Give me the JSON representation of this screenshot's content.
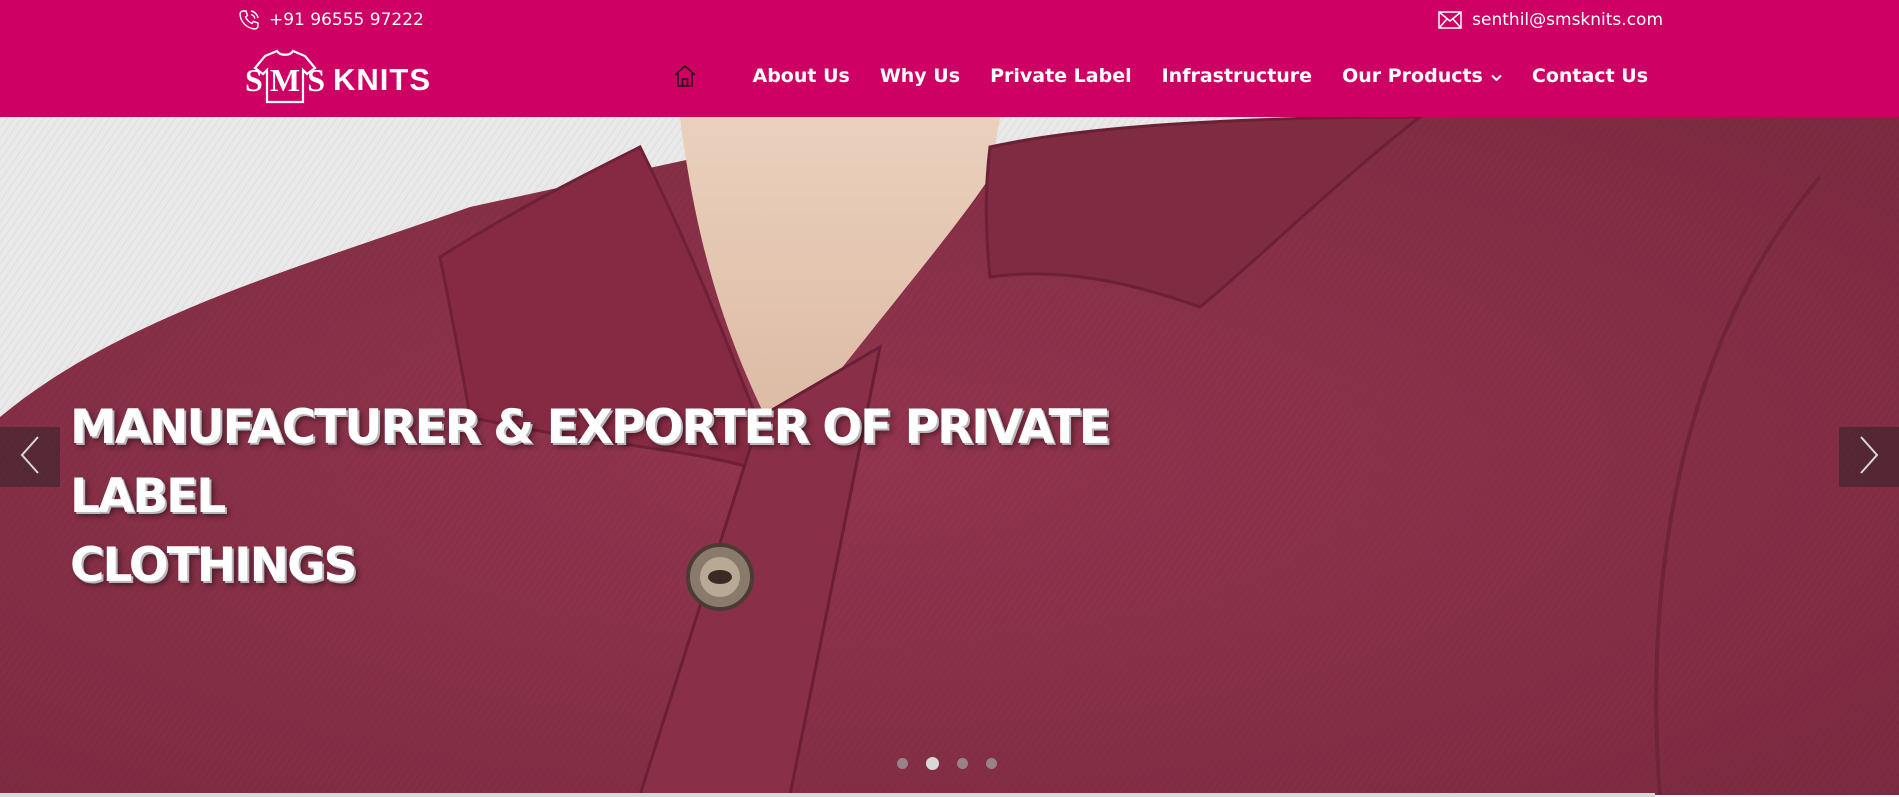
{
  "topbar": {
    "phone": "+91 96555 97222",
    "email": "senthil@smsknits.com"
  },
  "logo": {
    "monogram": [
      "S",
      "M",
      "S"
    ],
    "name": "KNITS"
  },
  "nav": {
    "home_icon": "home-icon",
    "items": [
      {
        "label": "About Us"
      },
      {
        "label": "Why Us"
      },
      {
        "label": "Private Label"
      },
      {
        "label": "Infrastructure"
      },
      {
        "label": "Our Products",
        "has_dropdown": true
      },
      {
        "label": "Contact Us"
      }
    ]
  },
  "hero": {
    "title_line1": "MANUFACTURER & EXPORTER OF PRIVATE LABEL",
    "title_line2": "CLOTHINGS",
    "prev_icon": "chevron-left-icon",
    "next_icon": "chevron-right-icon",
    "slide_count": 4,
    "active_slide": 2
  },
  "colors": {
    "brand": "#cf0063",
    "shirt": "#8c2e47",
    "skin": "#e6c7b3"
  }
}
